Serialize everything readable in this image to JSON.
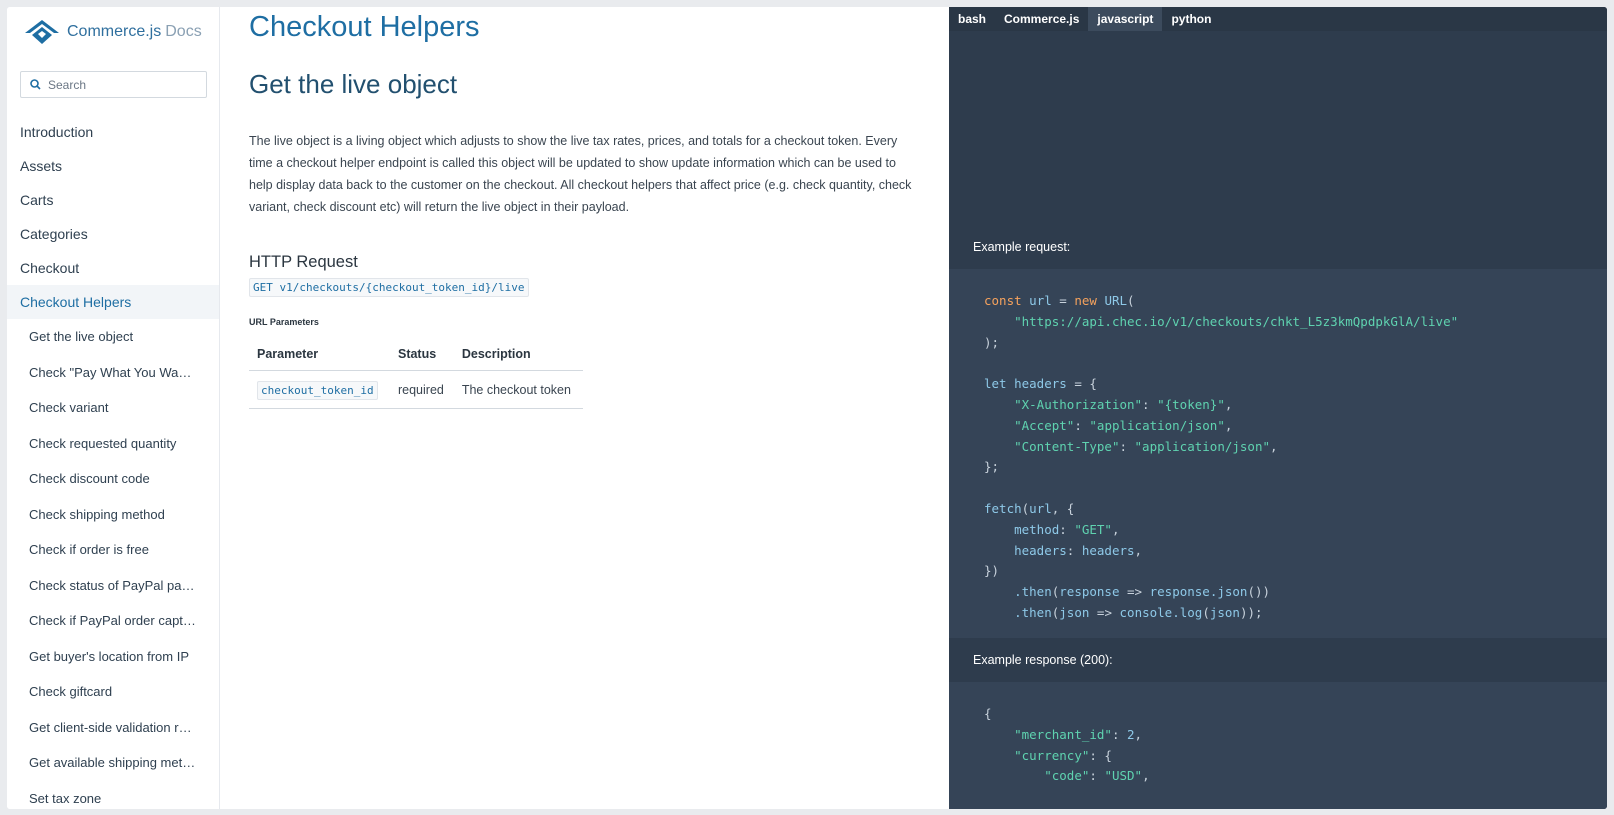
{
  "sidebar": {
    "logo_name": "Commerce.js",
    "logo_suffix": "Docs",
    "search_placeholder": "Search",
    "items": [
      {
        "label": "Introduction"
      },
      {
        "label": "Assets"
      },
      {
        "label": "Carts"
      },
      {
        "label": "Categories"
      },
      {
        "label": "Checkout"
      },
      {
        "label": "Checkout Helpers"
      }
    ],
    "sub_items": [
      {
        "label": "Get the live object"
      },
      {
        "label": "Check \"Pay What You Want\" amount"
      },
      {
        "label": "Check variant"
      },
      {
        "label": "Check requested quantity"
      },
      {
        "label": "Check discount code"
      },
      {
        "label": "Check shipping method"
      },
      {
        "label": "Check if order is free"
      },
      {
        "label": "Check status of PayPal payment"
      },
      {
        "label": "Check if PayPal order captured"
      },
      {
        "label": "Get buyer's location from IP"
      },
      {
        "label": "Check giftcard"
      },
      {
        "label": "Get client-side validation rules"
      },
      {
        "label": "Get available shipping methods"
      },
      {
        "label": "Set tax zone"
      }
    ]
  },
  "main": {
    "page_title": "Checkout Helpers",
    "section_title": "Get the live object",
    "paragraph": "The live object is a living object which adjusts to show the live tax rates, prices, and totals for a checkout token. Every time a checkout helper endpoint is called this object will be updated to show update information which can be used to help display data back to the customer on the checkout. All checkout helpers that affect price (e.g. check quantity, check variant, check discount etc) will return the live object in their payload.",
    "http_title": "HTTP Request",
    "endpoint": "GET v1/checkouts/{checkout_token_id}/live",
    "url_params_label": "URL Parameters",
    "table": {
      "headers": [
        "Parameter",
        "Status",
        "Description"
      ],
      "rows": [
        {
          "param": "checkout_token_id",
          "status": "required",
          "description": "The checkout token"
        }
      ]
    }
  },
  "code_panel": {
    "tabs": [
      {
        "label": "bash"
      },
      {
        "label": "Commerce.js"
      },
      {
        "label": "javascript"
      },
      {
        "label": "python"
      }
    ],
    "active_tab": "javascript",
    "request_label": "Example request:",
    "response_label": "Example response (200):",
    "request_url": "\"https://api.chec.io/v1/checkouts/chkt_L5z3kmQpdpkGlA/live\"",
    "header_auth_key": "\"X-Authorization\"",
    "header_auth_val": "\"{token}\"",
    "header_accept_key": "\"Accept\"",
    "header_accept_val": "\"application/json\"",
    "header_ct_key": "\"Content-Type\"",
    "header_ct_val": "\"application/json\"",
    "method_val": "\"GET\"",
    "response_merchant_key": "\"merchant_id\"",
    "response_merchant_val": "2",
    "response_currency_key": "\"currency\"",
    "response_code_key": "\"code\"",
    "response_code_val": "\"USD\""
  },
  "colors": {
    "accent": "#1e6ea3",
    "code_bg": "#354457",
    "panel_bg": "#2e3c4d",
    "keyword": "#f5a25d",
    "string": "#5fd3b0"
  }
}
